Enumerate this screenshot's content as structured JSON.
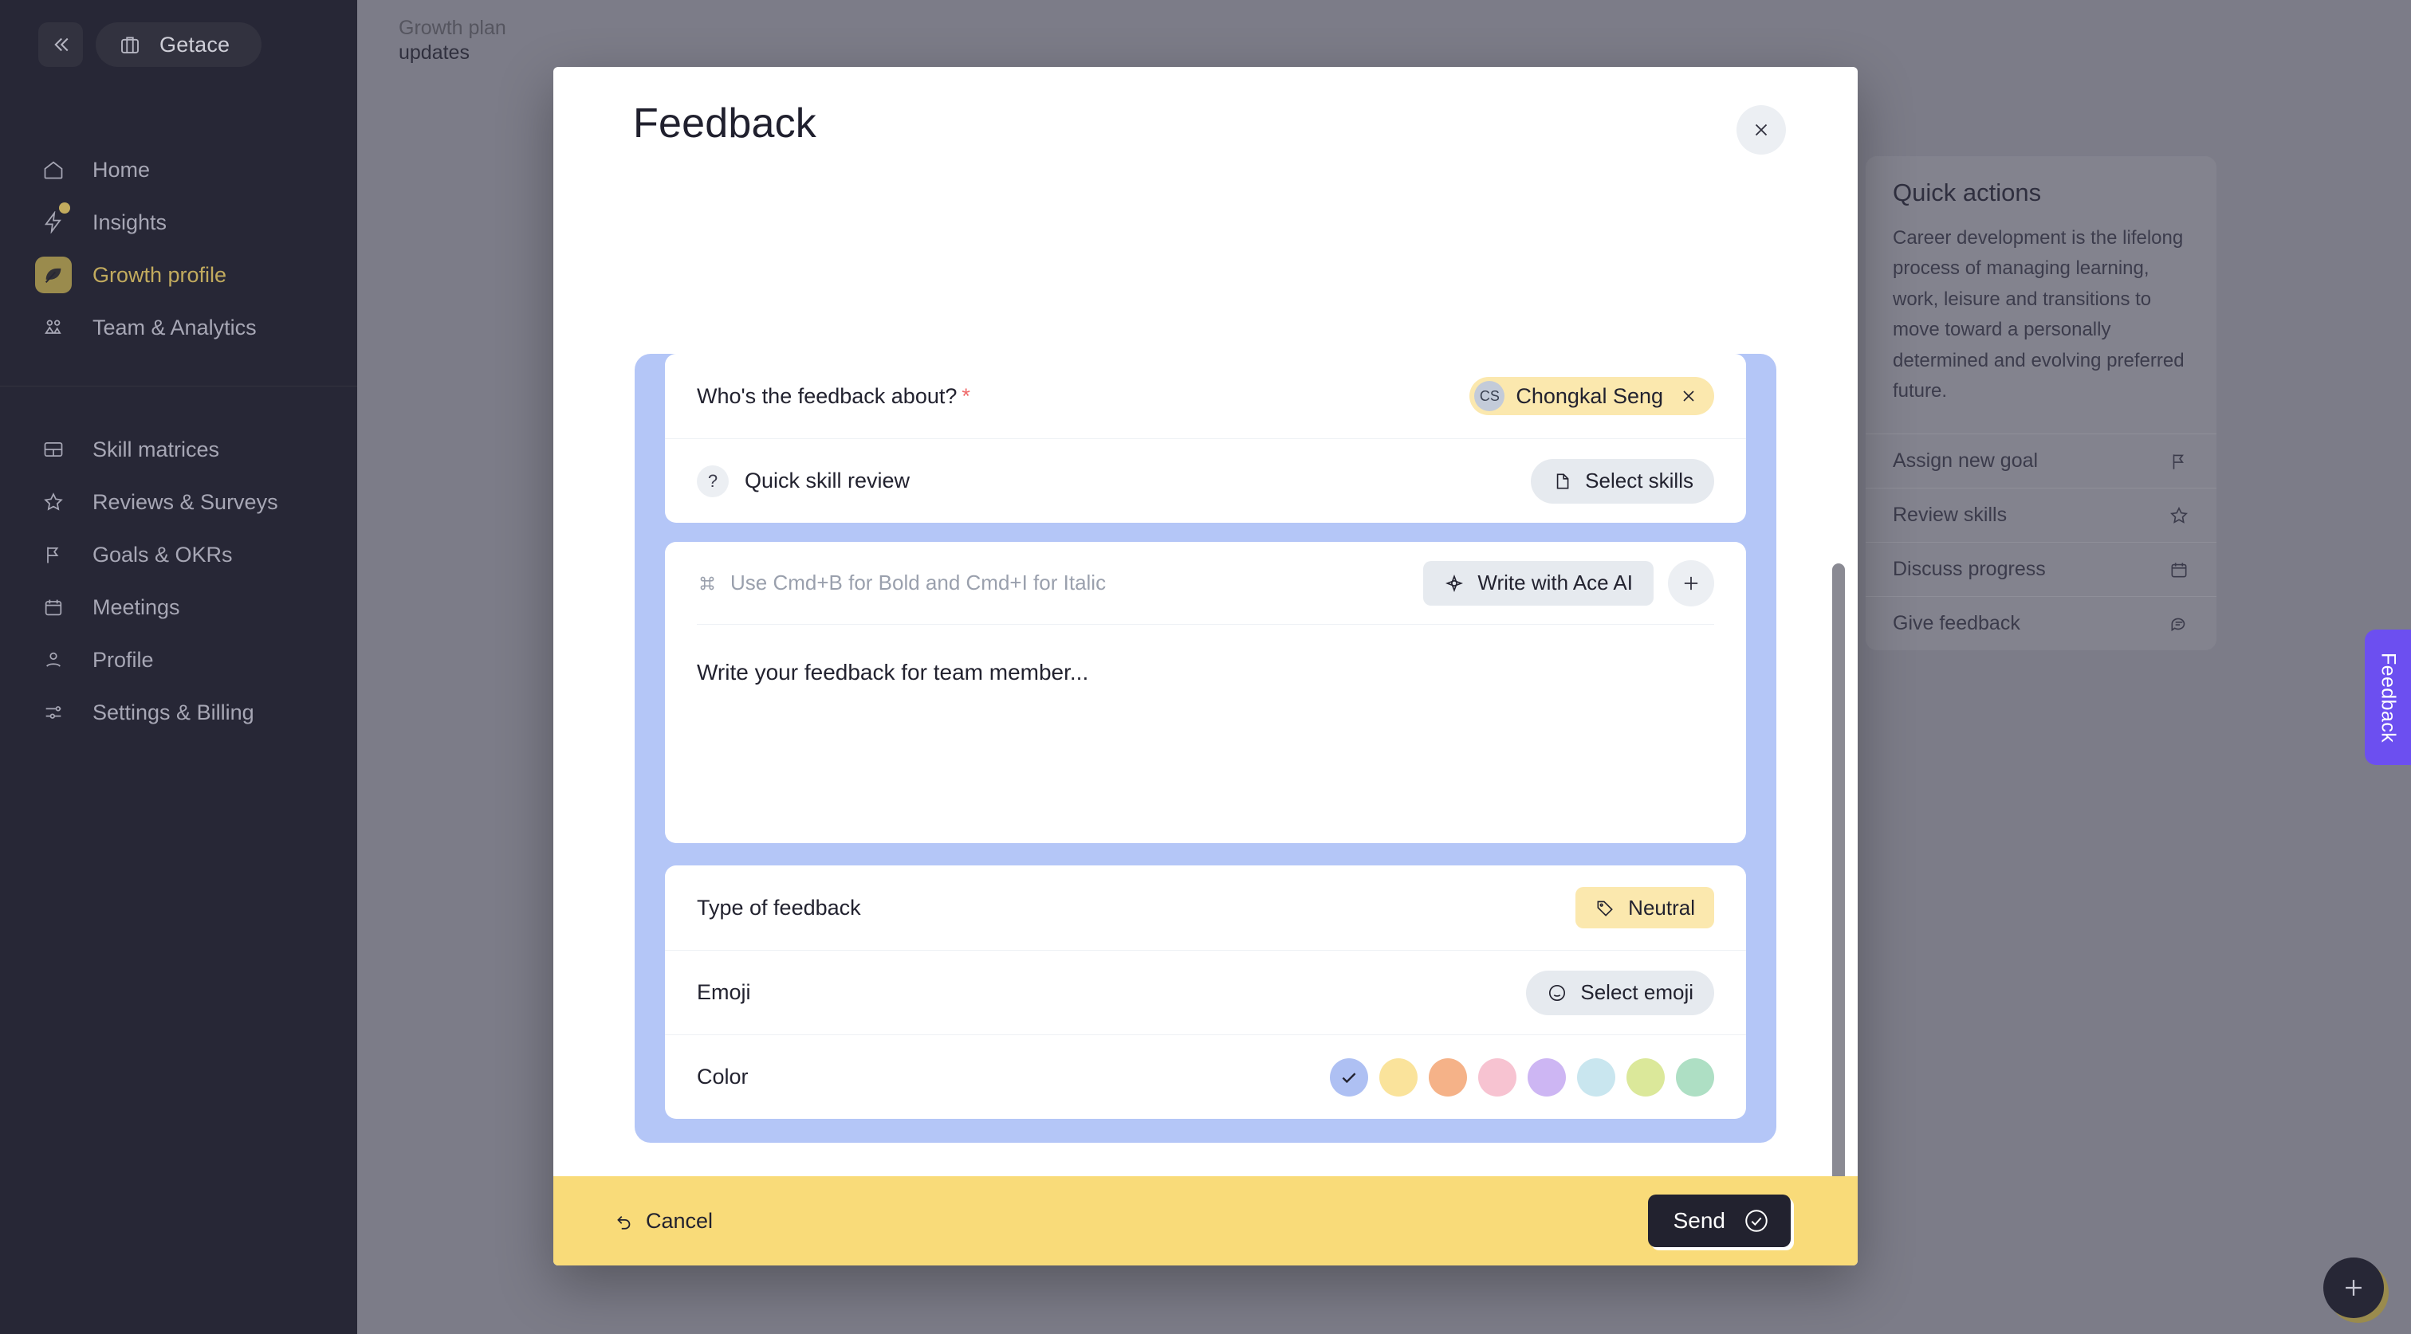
{
  "sidebar": {
    "brand": "Getace",
    "collapse_icon": "chevrons-left-icon",
    "nav_primary": [
      {
        "label": "Home",
        "icon": "home-icon",
        "active": false,
        "badge": false
      },
      {
        "label": "Insights",
        "icon": "bolt-icon",
        "active": false,
        "badge": true
      },
      {
        "label": "Growth profile",
        "icon": "leaf-icon",
        "active": true,
        "badge": false
      },
      {
        "label": "Team & Analytics",
        "icon": "users-icon",
        "active": false,
        "badge": false
      }
    ],
    "nav_secondary": [
      {
        "label": "Skill matrices",
        "icon": "layout-icon"
      },
      {
        "label": "Reviews & Surveys",
        "icon": "star-icon"
      },
      {
        "label": "Goals & OKRs",
        "icon": "flag-icon"
      },
      {
        "label": "Meetings",
        "icon": "calendar-icon"
      },
      {
        "label": "Profile",
        "icon": "user-icon"
      },
      {
        "label": "Settings & Billing",
        "icon": "sliders-icon"
      }
    ]
  },
  "page": {
    "breadcrumb_line1": "Growth plan",
    "breadcrumb_line2": "updates",
    "feedback_tab_label": "Feedback",
    "fab_icon": "plus-icon"
  },
  "quick_actions": {
    "title": "Quick actions",
    "description": "Career development is the lifelong process of managing learning, work, leisure and transitions to move toward a personally determined and evolving preferred future.",
    "items": [
      {
        "label": "Assign new goal",
        "icon": "flag-icon"
      },
      {
        "label": "Review skills",
        "icon": "star-icon"
      },
      {
        "label": "Discuss progress",
        "icon": "calendar-icon"
      },
      {
        "label": "Give feedback",
        "icon": "message-icon"
      }
    ]
  },
  "modal": {
    "title": "Feedback",
    "close_icon": "close-icon",
    "about_row": {
      "label": "Who's the feedback about?",
      "required_marker": "*",
      "person_initials": "CS",
      "person_name": "Chongkal Seng",
      "remove_icon": "close-icon"
    },
    "skill_row": {
      "icon": "question-icon",
      "label": "Quick skill review",
      "button_label": "Select skills",
      "button_icon": "document-icon"
    },
    "editor": {
      "hint_icon": "command-icon",
      "hint": "Use Cmd+B for Bold and Cmd+I for Italic",
      "ai_button_label": "Write with Ace AI",
      "ai_button_icon": "sparkle-icon",
      "add_icon": "plus-icon",
      "placeholder": "Write your feedback for team member..."
    },
    "type_row": {
      "label": "Type of feedback",
      "value": "Neutral",
      "icon": "tag-icon"
    },
    "emoji_row": {
      "label": "Emoji",
      "button_label": "Select emoji",
      "button_icon": "smiley-icon"
    },
    "color_row": {
      "label": "Color",
      "selected_index": 0,
      "check_icon": "check-icon",
      "swatches": [
        "#aec0f3",
        "#fae39b",
        "#f5b288",
        "#f7c3d1",
        "#cdb6f3",
        "#c9e6ef",
        "#dbe89a",
        "#aedfc4"
      ]
    },
    "footer": {
      "cancel_label": "Cancel",
      "cancel_icon": "undo-icon",
      "send_label": "Send",
      "send_icon": "check-circle-icon"
    }
  },
  "colors": {
    "sidebar_bg": "#272736",
    "accent_gold": "#c2ab5e",
    "panel_blue": "#b4c6f7",
    "footer_yellow": "#f9db79",
    "chip_yellow": "#fbe8ae",
    "dark": "#22222f",
    "feedback_purple": "#6c4ff0"
  }
}
